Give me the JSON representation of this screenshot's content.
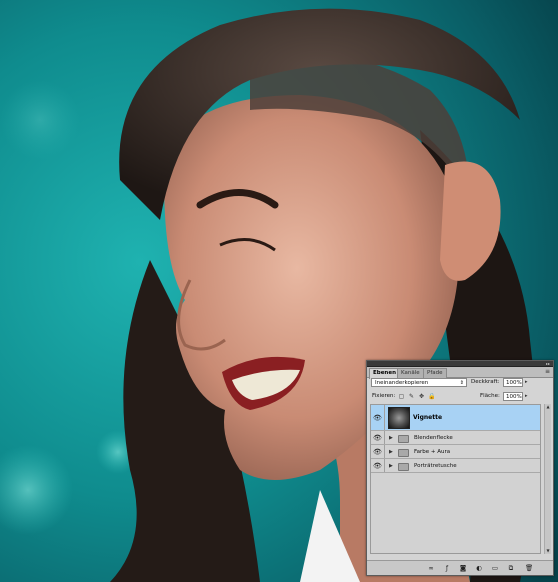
{
  "panel": {
    "tabs": [
      {
        "label": "Ebenen"
      },
      {
        "label": "Kanäle"
      },
      {
        "label": "Pfade"
      }
    ],
    "menu_icon": "panel-menu-icon",
    "blend_mode": "Ineinanderkopieren",
    "opacity_label": "Deckkraft:",
    "opacity_value": "100%",
    "lock_label": "Fixieren:",
    "fill_label": "Fläche:",
    "fill_value": "100%",
    "layers": [
      {
        "name": "Vignette",
        "type": "layer",
        "visible": true,
        "selected": true
      },
      {
        "name": "Blendenflecke",
        "type": "group",
        "visible": true
      },
      {
        "name": "Farbe + Aura",
        "type": "group",
        "visible": true
      },
      {
        "name": "Porträtretusche",
        "type": "group",
        "visible": true
      }
    ],
    "footer_icons": [
      "link-icon",
      "fx-icon",
      "mask-icon",
      "adjustment-icon",
      "group-icon",
      "new-layer-icon",
      "trash-icon"
    ]
  },
  "colors": {
    "background_teal": "#0f7f84",
    "selected_row": "#a8d2f4",
    "panel_bg": "#d4d4d4"
  }
}
